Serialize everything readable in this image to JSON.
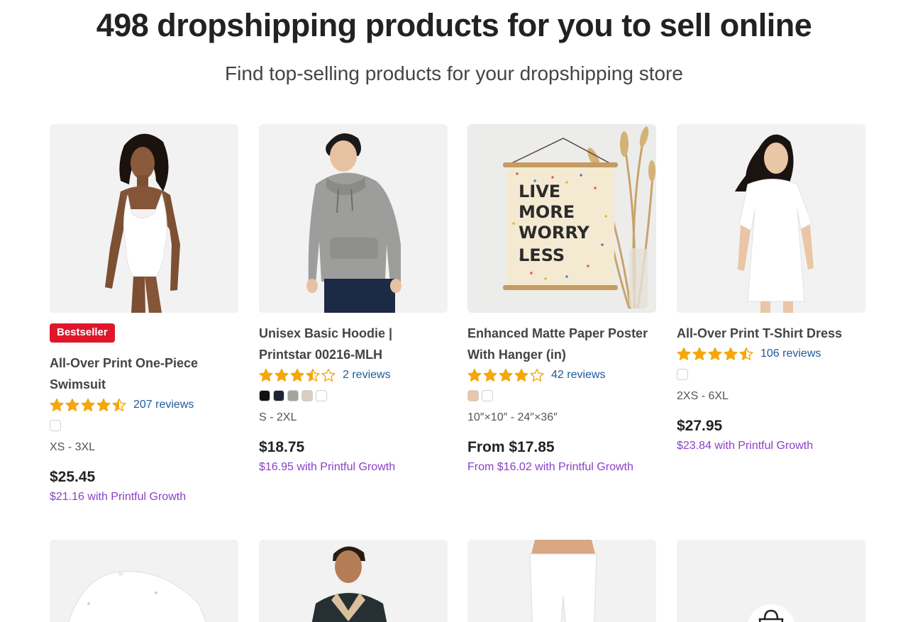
{
  "header": {
    "title": "498 dropshipping products for you to sell online",
    "subtitle": "Find top-selling products for your dropshipping store"
  },
  "products": [
    {
      "badge": "Bestseller",
      "title_line1": "All-Over Print One-Piece",
      "title_line2": "Swimsuit",
      "rating": 4.5,
      "reviews": "207 reviews",
      "swatch_colors": [
        "#ffffff"
      ],
      "sizes": "XS - 3XL",
      "price": "$25.45",
      "growth_price": "$21.16 with Printful Growth"
    },
    {
      "title_line1": "Unisex Basic Hoodie |",
      "title_line2": "Printstar 00216-MLH",
      "rating": 3.5,
      "reviews": "2 reviews",
      "swatch_colors": [
        "#111111",
        "#1f2433",
        "#a3a3a0",
        "#d9cfbe",
        "#ffffff"
      ],
      "sizes": "S - 2XL",
      "price": "$18.75",
      "growth_price": "$16.95 with Printful Growth"
    },
    {
      "title_line1": "Enhanced Matte Paper Poster",
      "title_line2": "With Hanger (in)",
      "rating": 4,
      "reviews": "42 reviews",
      "swatch_colors": [
        "#e8c8a6",
        "#ffffff"
      ],
      "sizes": "10″×10″ - 24″×36″",
      "price": "From $17.85",
      "growth_price": "From $16.02 with Printful Growth",
      "poster_text": [
        "LIVE",
        "MORE",
        "WORRY",
        "LESS"
      ]
    },
    {
      "title_line1": "All-Over Print T-Shirt Dress",
      "rating": 4.5,
      "reviews": "106 reviews",
      "swatch_colors": [
        "#ffffff"
      ],
      "sizes": "2XS - 6XL",
      "price": "$27.95",
      "growth_price": "$23.84 with Printful Growth"
    }
  ],
  "colors": {
    "star": "#f5a70a",
    "badge": "#e0162b",
    "reviews_link": "#1d5a9a",
    "growth": "#8a3fc9"
  },
  "icons": [
    "star-icon",
    "half-star-icon",
    "empty-star-icon",
    "shopping-bag-icon"
  ]
}
